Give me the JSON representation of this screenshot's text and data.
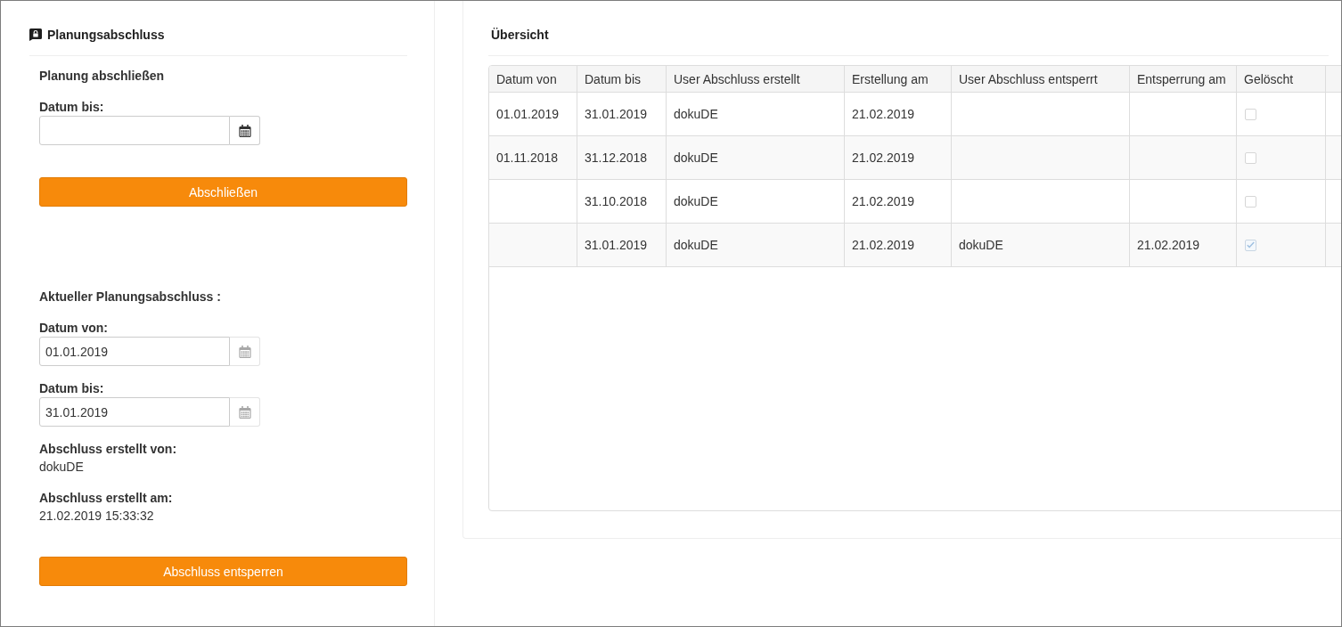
{
  "planning_close": {
    "title": "Planungsabschluss",
    "heading": "Planung abschließen",
    "fields": [
      {
        "label": "Datum bis:",
        "disabled": false
      }
    ],
    "button": "Abschließen"
  },
  "current_close": {
    "heading": "Aktueller Planungsabschluss :",
    "fields": [
      {
        "label": "Datum von:",
        "value": "01.01.2019",
        "disabled": true
      },
      {
        "label": "Datum bis:",
        "value": "31.01.2019",
        "disabled": true
      }
    ],
    "info": [
      {
        "label": "Abschluss erstellt von:",
        "value": "dokuDE"
      },
      {
        "label": "Abschluss erstellt am:",
        "value": "21.02.2019 15:33:32"
      }
    ],
    "button": "Abschluss entsperren"
  },
  "overview": {
    "title": "Übersicht",
    "table": {
      "columns": [
        "Datum von",
        "Datum bis",
        "User Abschluss erstellt",
        "Erstellung am",
        "User Abschluss entsperrt",
        "Entsperrung am",
        "Gelöscht"
      ],
      "rows": [
        {
          "cells": [
            "01.01.2019",
            "31.01.2019",
            "dokuDE",
            "21.02.2019",
            null,
            null
          ],
          "checked": false
        },
        {
          "cells": [
            "01.11.2018",
            "31.12.2018",
            "dokuDE",
            "21.02.2019",
            null,
            null
          ],
          "checked": false
        },
        {
          "cells": [
            null,
            "31.10.2018",
            "dokuDE",
            "21.02.2019",
            null,
            null
          ],
          "checked": false
        },
        {
          "cells": [
            null,
            "31.01.2019",
            "dokuDE",
            "21.02.2019",
            "dokuDE",
            "21.02.2019"
          ],
          "checked": true
        }
      ]
    }
  }
}
